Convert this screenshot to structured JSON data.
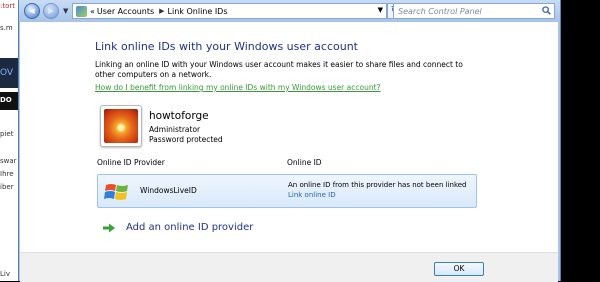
{
  "background": {
    "left_snippets": [
      ":tort",
      "s.m",
      "OV",
      "DO",
      "piet",
      "swar",
      "Ihre",
      "iber",
      "Liv"
    ]
  },
  "navigation": {
    "back_glyph": "◀",
    "forward_glyph": "▶",
    "breadcrumb_prefix": "«",
    "breadcrumbs": [
      "User Accounts",
      "Link Online IDs"
    ],
    "search_placeholder": "Search Control Panel"
  },
  "page": {
    "title": "Link online IDs with your Windows user account",
    "description": "Linking an online ID with your Windows user account makes it easier to share files and connect to other computers on a network.",
    "help_link": "How do I benefit from linking my online IDs with my Windows user account?"
  },
  "user": {
    "name": "howtoforge",
    "role": "Administrator",
    "password_status": "Password protected"
  },
  "providers_table": {
    "col_provider": "Online ID Provider",
    "col_online_id": "Online ID",
    "rows": [
      {
        "provider": "WindowsLiveID",
        "status": "An online ID from this provider has not been linked",
        "link": "Link online ID"
      }
    ]
  },
  "add_provider_label": "Add an online ID provider",
  "buttons": {
    "ok": "OK"
  },
  "colors": {
    "title_blue": "#1e3287",
    "link_green": "#3a9a3a",
    "link_blue": "#1f63c2",
    "row_border": "#9ec2ea"
  }
}
